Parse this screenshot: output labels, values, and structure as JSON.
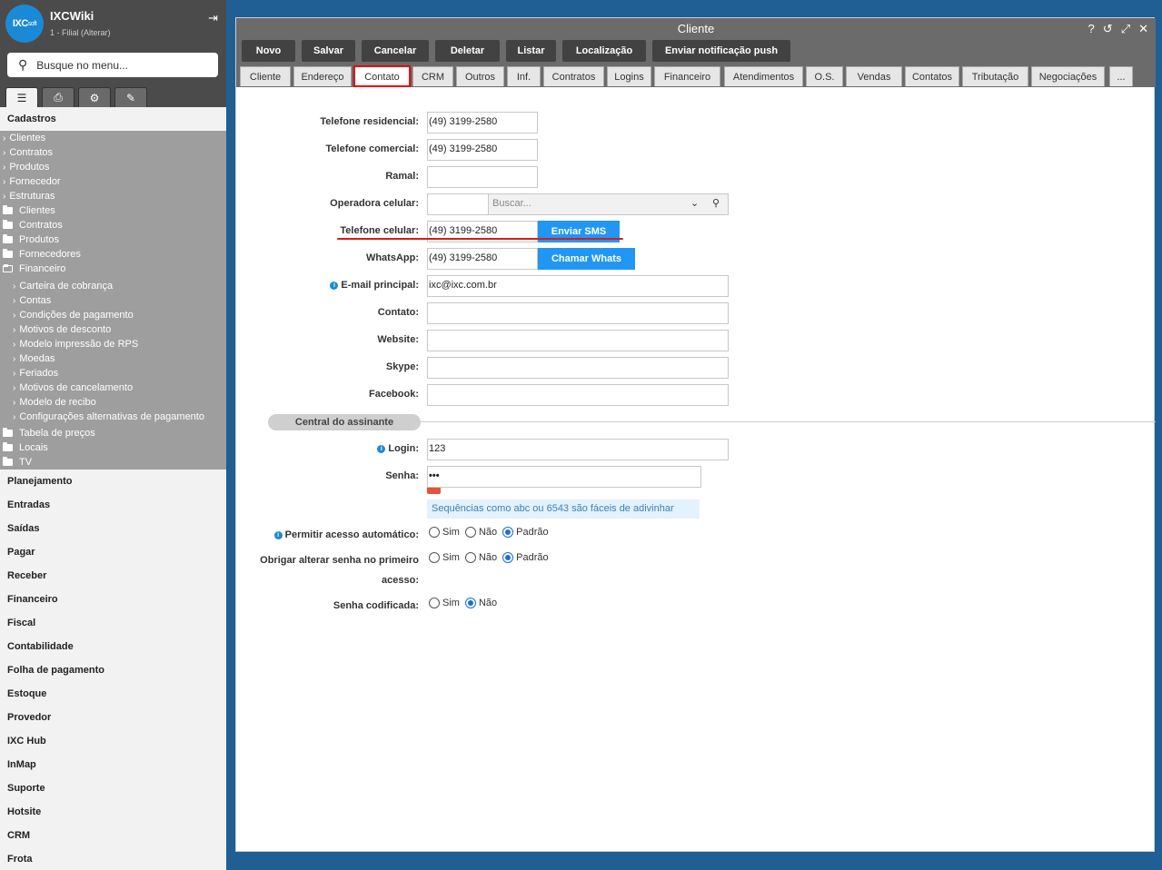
{
  "sidebar": {
    "logo_text": "IXC",
    "logo_small": "soft",
    "app_name": "IXCWiki",
    "filial": "1 - Filial (Alterar)",
    "search_placeholder": "Busque no menu...",
    "section_title": "Cadastros",
    "cad_items": [
      "Clientes",
      "Contratos",
      "Produtos",
      "Fornecedor",
      "Estruturas",
      "Clientes",
      "Contratos",
      "Produtos",
      "Fornecedores",
      "Financeiro",
      "Carteira de cobrança",
      "Contas",
      "Condições de pagamento",
      "Motivos de desconto",
      "Modelo impressão de RPS",
      "Moedas",
      "Feriados",
      "Motivos de cancelamento",
      "Modelo de recibo",
      "Configurações alternativas de pagamento",
      "Tabela de preços",
      "Locais",
      "TV"
    ],
    "groups": [
      "Planejamento",
      "Entradas",
      "Saídas",
      "Pagar",
      "Receber",
      "Financeiro",
      "Fiscal",
      "Contabilidade",
      "Folha de pagamento",
      "Estoque",
      "Provedor",
      "IXC Hub",
      "InMap",
      "Suporte",
      "Hotsite",
      "CRM",
      "Frota"
    ]
  },
  "window": {
    "title": "Cliente",
    "toolbar": [
      "Novo",
      "Salvar",
      "Cancelar",
      "Deletar",
      "Listar",
      "Localização",
      "Enviar notificação push"
    ],
    "tabs": [
      "Cliente",
      "Endereço",
      "Contato",
      "CRM",
      "Outros",
      "Inf.",
      "Contratos",
      "Logins",
      "Financeiro",
      "Atendimentos",
      "O.S.",
      "Vendas",
      "Contatos",
      "Tributação",
      "Negociações",
      "..."
    ],
    "active_tab": "Contato"
  },
  "form": {
    "tel_res_label": "Telefone residencial:",
    "tel_res": "(49) 3199-2580",
    "tel_com_label": "Telefone comercial:",
    "tel_com": "(49) 3199-2580",
    "ramal_label": "Ramal:",
    "ramal": "",
    "operadora_label": "Operadora celular:",
    "operadora_placeholder": "Buscar...",
    "tel_cel_label": "Telefone celular:",
    "tel_cel": "(49) 3199-2580",
    "sms_button": "Enviar SMS",
    "whatsapp_label": "WhatsApp:",
    "whatsapp": "(49) 3199-2580",
    "whats_button": "Chamar Whats",
    "email_label": "E-mail principal:",
    "email": "ixc@ixc.com.br",
    "contato_label": "Contato:",
    "website_label": "Website:",
    "skype_label": "Skype:",
    "facebook_label": "Facebook:",
    "section": "Central do assinante",
    "login_label": "Login:",
    "login": "123",
    "senha_label": "Senha:",
    "senha": "•••",
    "senha_hint": "Sequências como abc ou 6543 são fáceis de adivinhar",
    "auto_label": "Permitir acesso automático:",
    "obrigar_label_1": "Obrigar alterar senha no primeiro",
    "obrigar_label_2": "acesso:",
    "codificada_label": "Senha codificada:",
    "opt_sim": "Sim",
    "opt_nao": "Não",
    "opt_padrao": "Padrão"
  }
}
